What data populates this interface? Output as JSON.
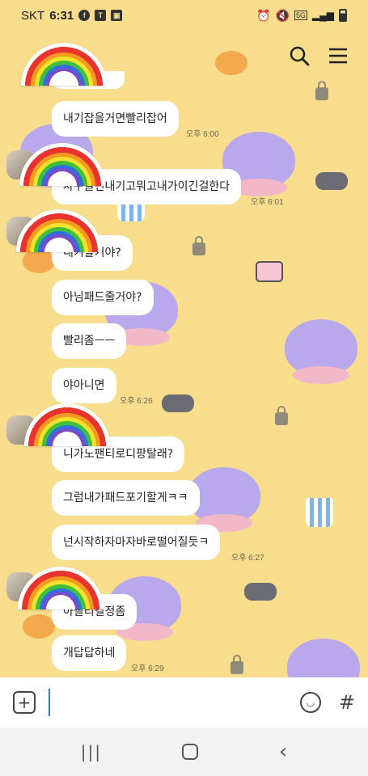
{
  "status": {
    "carrier": "SKT",
    "time": "6:31",
    "icons_left": [
      "facebook-icon",
      "talk-icon",
      "image-icon"
    ],
    "icons_right": [
      "alarm-icon",
      "mute-icon",
      "5g-icon",
      "signal-icon",
      "battery-icon"
    ],
    "network_label": "5G"
  },
  "header": {
    "icons": [
      "search-icon",
      "menu-icon"
    ]
  },
  "messages": [
    {
      "text": "내기잡을거면빨리잡어",
      "time": "오후 6:00"
    },
    {
      "text": "자꾸끌면내기고뭐고내가이긴걸한다",
      "time": "오후 6:01"
    },
    {
      "text": "내기할거야?",
      "time": ""
    },
    {
      "text": "아님패드줄거야?",
      "time": ""
    },
    {
      "text": "빨리좀ㅡㅡ",
      "time": ""
    },
    {
      "text": "야아니면",
      "time": "오후 6:26"
    },
    {
      "text": "니가노팬티로디팡탈래?",
      "time": ""
    },
    {
      "text": "그럼내가패드포기할게ㅋㅋ",
      "time": ""
    },
    {
      "text": "넌시작하자마자바로떨어질듯ㅋ",
      "time": "오후 6:27"
    },
    {
      "text": "아빨리결정좀",
      "time": ""
    },
    {
      "text": "개답답하네",
      "time": "오후 6:29"
    }
  ],
  "input": {
    "placeholder": "",
    "value": ""
  },
  "colors": {
    "chat_bg": "#f7dd8c",
    "bubble": "#ffffff",
    "caret": "#3b6fd8"
  }
}
